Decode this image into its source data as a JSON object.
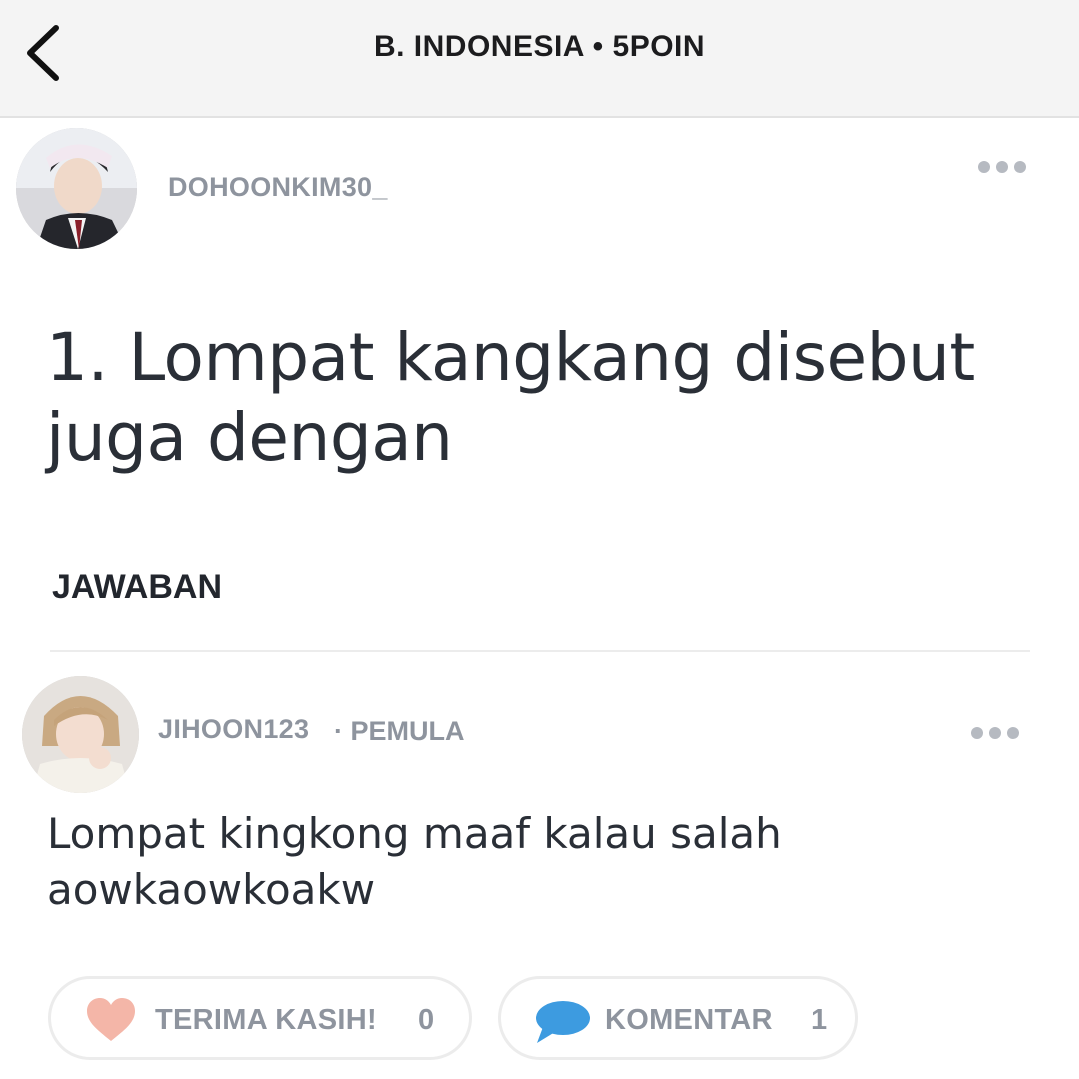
{
  "header": {
    "title": "B. INDONESIA • 5POIN"
  },
  "question": {
    "author": "DOHOONKIM30_",
    "text": "1. Lompat kangkang disebut juga dengan",
    "avatar_icon": "user-avatar-photo",
    "more_icon": "more-dots-icon"
  },
  "answers_section": {
    "label": "JAWABAN"
  },
  "answer": {
    "author": "JIHOON123",
    "rank": "· PEMULA",
    "text": "Lompat kingkong maaf kalau salah aowkaowkoakw",
    "avatar_icon": "user-avatar-photo",
    "more_icon": "more-dots-icon",
    "thanks": {
      "label": "TERIMA KASIH!",
      "count": "0",
      "icon": "heart-icon",
      "color": "#f4b6a8"
    },
    "comments": {
      "label": "KOMENTAR",
      "count": "1",
      "icon": "speech-bubble-icon",
      "color": "#3d9be0"
    }
  }
}
